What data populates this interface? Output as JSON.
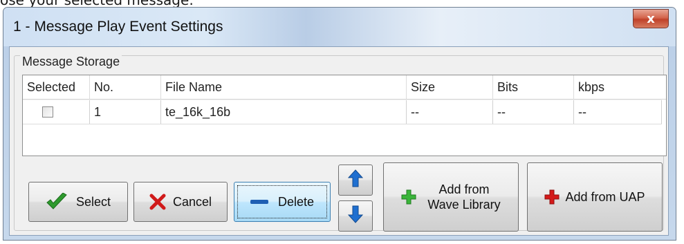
{
  "background_caption": "ose your selected message:",
  "window": {
    "title": "1 - Message Play Event Settings",
    "close_glyph": "x"
  },
  "group": {
    "label": "Message Storage"
  },
  "table": {
    "columns": [
      "Selected",
      "No.",
      "File Name",
      "Size",
      "Bits",
      "kbps"
    ],
    "rows": [
      {
        "selected": false,
        "no": "1",
        "file_name": "te_16k_16b",
        "size": "--",
        "bits": "--",
        "kbps": "--"
      }
    ]
  },
  "buttons": {
    "select": {
      "label": "Select",
      "icon": "checkmark-icon",
      "color": "#2e9a2e"
    },
    "cancel": {
      "label": "Cancel",
      "icon": "x-icon",
      "color": "#d01a1a"
    },
    "delete": {
      "label": "Delete",
      "icon": "minus-icon",
      "color": "#1f5fb3"
    },
    "move_up": {
      "icon": "arrow-up-icon",
      "color": "#1f6fd0"
    },
    "move_down": {
      "icon": "arrow-down-icon",
      "color": "#1f6fd0"
    },
    "add_wave": {
      "label_line1": "Add from",
      "label_line2": "Wave Library",
      "icon": "plus-icon",
      "color": "#3ab53a"
    },
    "add_uap": {
      "label": "Add from UAP",
      "icon": "plus-icon",
      "color": "#d41a1a"
    }
  }
}
